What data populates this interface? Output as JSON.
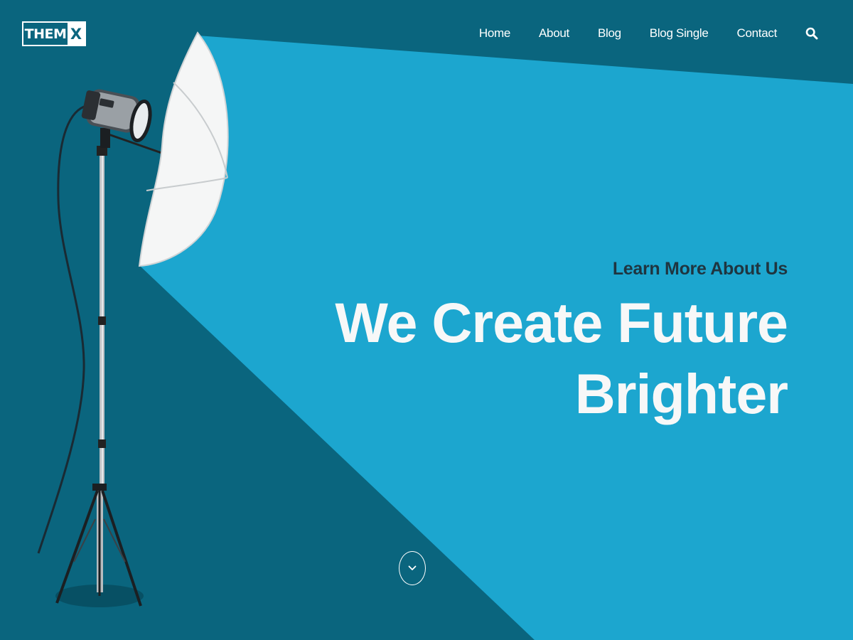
{
  "brand": {
    "logo_main": "THEM",
    "logo_accent": "X"
  },
  "nav": {
    "items": [
      "Home",
      "About",
      "Blog",
      "Blog Single",
      "Contact"
    ]
  },
  "hero": {
    "subtitle": "Learn More About Us",
    "title_line1": "We Create Future",
    "title_line2": "Brighter"
  },
  "icons": {
    "search": "search-icon",
    "scroll": "chevron-down-icon"
  },
  "colors": {
    "background": "#0a657e",
    "beam": "#1ca6cf",
    "subtitle": "#1f3540",
    "text": "#ffffff"
  }
}
